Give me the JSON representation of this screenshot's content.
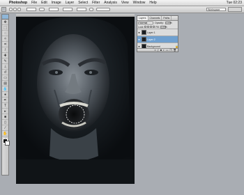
{
  "menubar": {
    "apple_icon": "apple-icon",
    "items": [
      "Photoshop",
      "File",
      "Edit",
      "Image",
      "Layer",
      "Select",
      "Filter",
      "Analysis",
      "View",
      "Window",
      "Help"
    ],
    "clock": "Tue 02:23"
  },
  "optionsbar": {
    "workspace_value": "Workspace"
  },
  "layers_panel": {
    "tabs": [
      "Layers",
      "Channels",
      "Paths"
    ],
    "blend_mode": "Normal",
    "opacity_label": "Opacity:",
    "opacity_value": "100%",
    "lock_label": "Lock:",
    "fill_label": "Fill:",
    "fill_value": "100%",
    "layers": [
      {
        "name": "Layer 1",
        "visible": true,
        "selected": false
      },
      {
        "name": "Layer 2",
        "visible": true,
        "selected": true
      },
      {
        "name": "Background",
        "visible": true,
        "selected": false,
        "locked": true
      }
    ]
  },
  "colors": {
    "selection": "#6fa0d0",
    "canvas_bg": "#0c0f12",
    "app_bg": "#a9adb3"
  }
}
